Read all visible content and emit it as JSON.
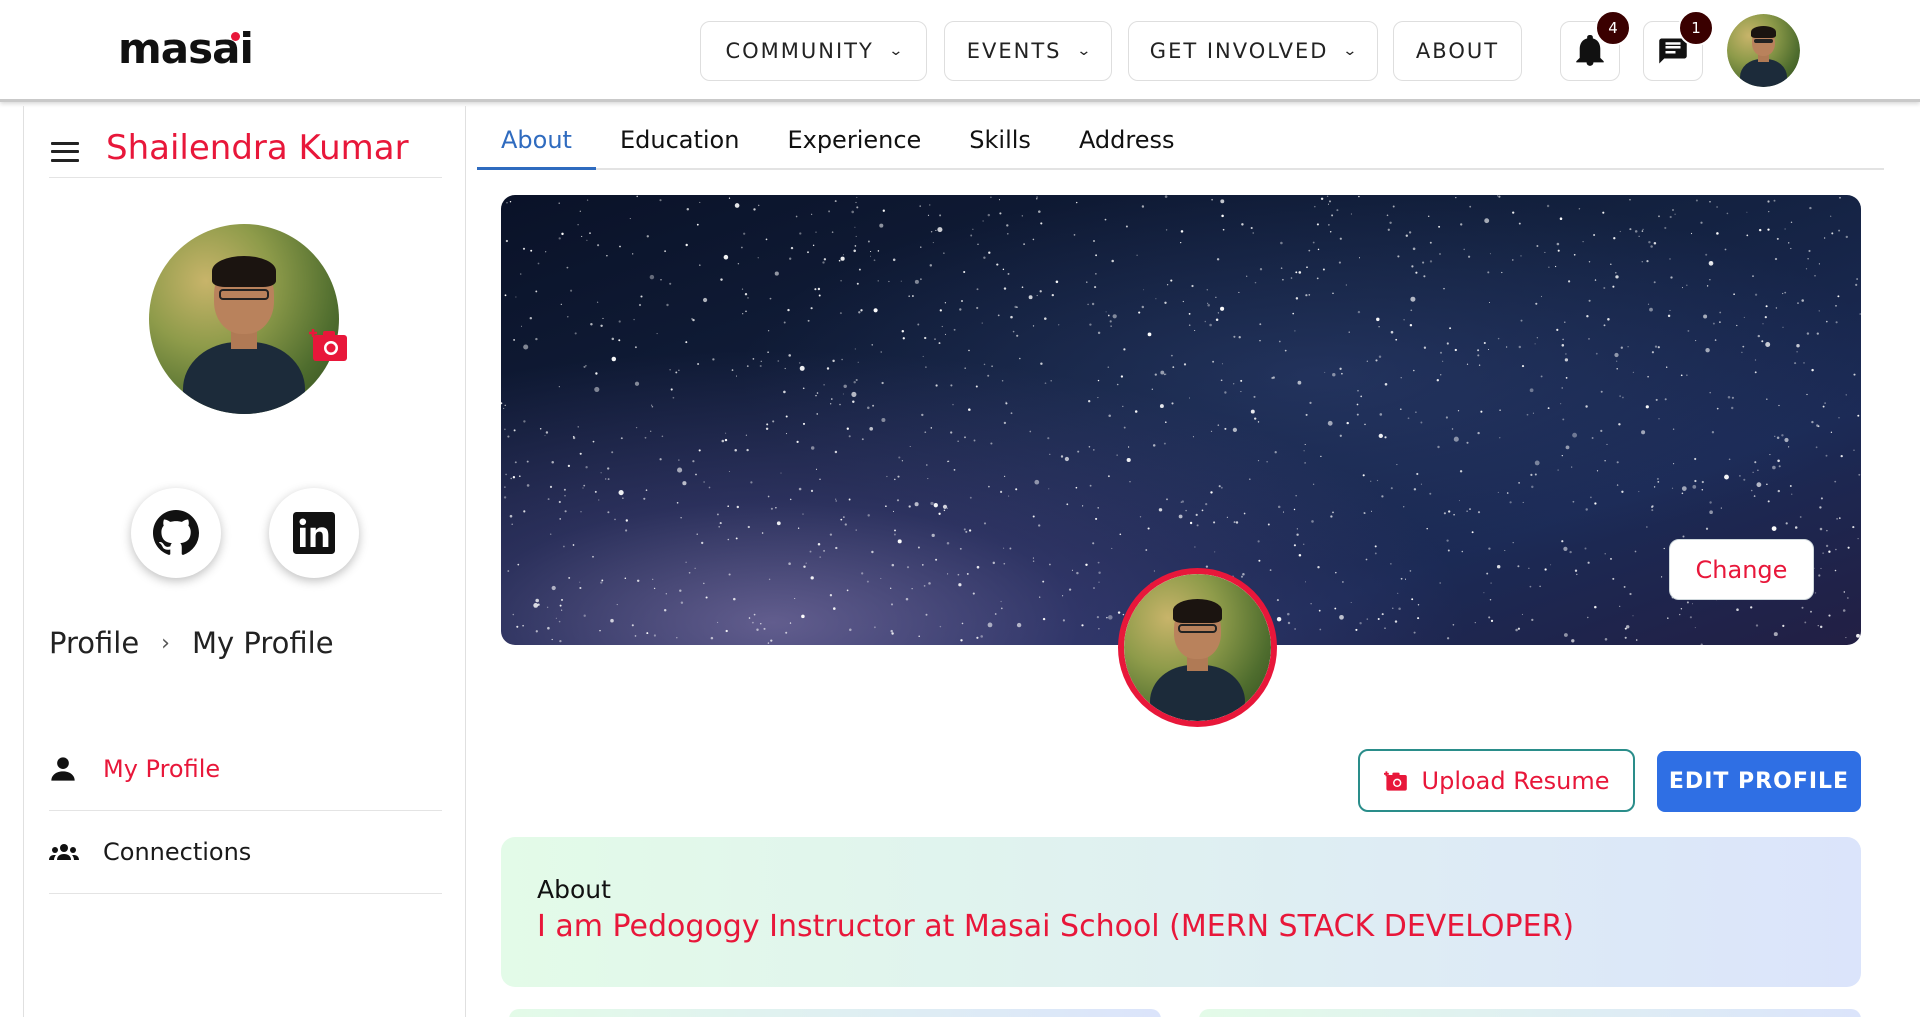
{
  "brand": {
    "logo_text": "masai"
  },
  "nav": {
    "items": [
      {
        "label": "COMMUNITY",
        "has_dropdown": true
      },
      {
        "label": "EVENTS",
        "has_dropdown": true
      },
      {
        "label": "GET INVOLVED",
        "has_dropdown": true
      },
      {
        "label": "ABOUT",
        "has_dropdown": false
      }
    ],
    "notifications": {
      "icon": "bell-icon",
      "count": "4"
    },
    "messages": {
      "icon": "chat-icon",
      "count": "1"
    }
  },
  "sidebar": {
    "user_name": "Shailendra Kumar",
    "breadcrumb": {
      "root": "Profile",
      "current": "My Profile"
    },
    "social": [
      {
        "icon": "github-icon"
      },
      {
        "icon": "linkedin-icon"
      }
    ],
    "menu": [
      {
        "label": "My Profile",
        "icon": "person-icon",
        "active": true
      },
      {
        "label": "Connections",
        "icon": "people-icon",
        "active": false
      }
    ]
  },
  "tabs": [
    {
      "label": "About",
      "active": true
    },
    {
      "label": "Education",
      "active": false
    },
    {
      "label": "Experience",
      "active": false
    },
    {
      "label": "Skills",
      "active": false
    },
    {
      "label": "Address",
      "active": false
    }
  ],
  "banner": {
    "change_label": "Change"
  },
  "actions": {
    "upload_resume_label": "Upload Resume",
    "edit_profile_label": "EDIT PROFILE"
  },
  "about": {
    "title": "About",
    "text": "I am Pedogogy Instructor at Masai School (MERN STACK DEVELOPER)"
  },
  "colors": {
    "accent": "#e8173a",
    "primary": "#2f6fe4",
    "tab_active": "#2f6bbf",
    "badge": "#3a0000"
  }
}
